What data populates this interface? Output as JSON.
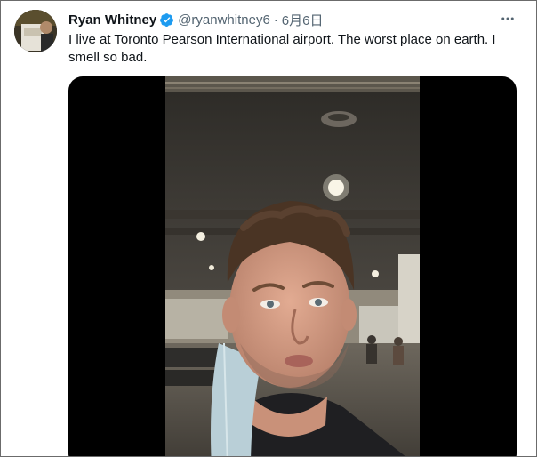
{
  "tweet": {
    "author": {
      "display_name": "Ryan Whitney",
      "handle": "@ryanwhitney6",
      "verified": true,
      "avatar_icon": "user-avatar"
    },
    "separator": "·",
    "date": "6月6日",
    "text": "I live at Toronto Pearson International airport. The worst place on earth. I smell so bad.",
    "more_icon": "more-horizontal-icon",
    "media": {
      "type": "video"
    }
  },
  "colors": {
    "verified_blue": "#1d9bf0",
    "text_primary": "#0f1419",
    "text_secondary": "#536471",
    "media_background": "#000000"
  }
}
